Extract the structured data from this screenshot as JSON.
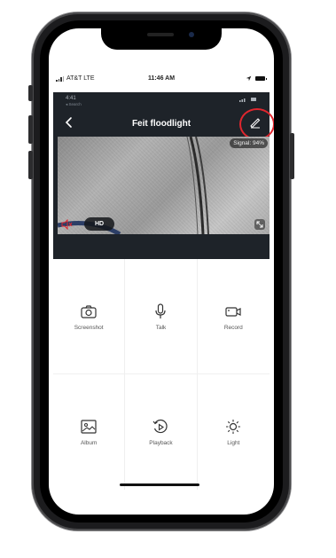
{
  "status_bar": {
    "carrier": "AT&T LTE",
    "time": "11:46 AM"
  },
  "app_status": {
    "time": "4:41",
    "sub": "◂ Search"
  },
  "header": {
    "title": "Feit floodlight"
  },
  "video": {
    "signal": "Signal: 94%",
    "quality": "HD"
  },
  "actions": [
    {
      "label": "Screenshot",
      "icon": "camera-icon"
    },
    {
      "label": "Talk",
      "icon": "microphone-icon"
    },
    {
      "label": "Record",
      "icon": "video-camera-icon"
    },
    {
      "label": "Album",
      "icon": "image-icon"
    },
    {
      "label": "Playback",
      "icon": "playback-icon"
    },
    {
      "label": "Light",
      "icon": "sun-icon"
    }
  ],
  "colors": {
    "header_bg": "#1e2329",
    "highlight": "#e0262e"
  }
}
